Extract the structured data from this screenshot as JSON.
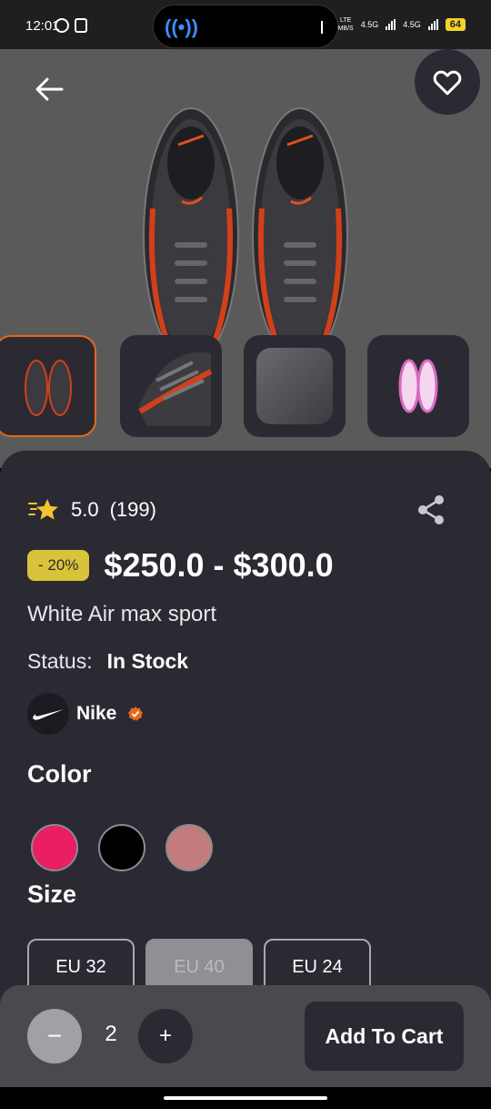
{
  "status_bar": {
    "time": "12:01",
    "network_speed": "LTE\nMB/S",
    "signal_1": "4.5G",
    "signal_2": "4.5G",
    "battery": "64"
  },
  "product": {
    "rating": "5.0",
    "reviews": "(199)",
    "discount": "- 20%",
    "price": "$250.0 - $300.0",
    "name": "White Air max sport",
    "status_label": "Status:",
    "status_value": "In Stock",
    "brand": "Nike"
  },
  "sections": {
    "color_title": "Color",
    "size_title": "Size"
  },
  "colors": [
    "#e91e63",
    "#000000",
    "#c27c7c"
  ],
  "sizes": [
    {
      "label": "EU 32",
      "selected": false
    },
    {
      "label": "EU 40",
      "selected": true
    },
    {
      "label": "EU 24",
      "selected": false
    }
  ],
  "cart": {
    "quantity": "2",
    "minus": "−",
    "plus": "+",
    "add_label": "Add To Cart"
  },
  "theme": {
    "accent_orange": "#e5691c",
    "badge_yellow": "#d9c33a",
    "card_bg": "#2b2a33"
  }
}
